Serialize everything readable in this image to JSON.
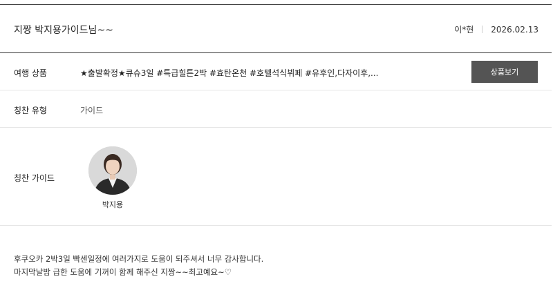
{
  "review": {
    "title": "지짱 박지용가이드님~~",
    "author": "이*현",
    "date": "2026.02.13"
  },
  "product": {
    "label": "여행 상품",
    "name": "★출발확정★큐슈3일 #특급힐튼2박 #효탄온천 #호텔석식뷔페 #유후인,다자이후,...",
    "button_label": "상품보기"
  },
  "praise_type": {
    "label": "칭찬 유형",
    "value": "가이드"
  },
  "praise_guide": {
    "label": "칭찬 가이드",
    "guide_name": "박지용"
  },
  "content": {
    "lines": [
      "후쿠오카 2박3일 빡센일정에 여러가지로 도움이 되주셔서 너무 감사합니다.",
      "마지막날밤 급한 도움에 기꺼이 함께 해주신 지짱~~최고예요~♡"
    ]
  },
  "colors": {
    "button_bg": "#545454",
    "divider": "#e6e6e6",
    "header_line": "#333333"
  }
}
